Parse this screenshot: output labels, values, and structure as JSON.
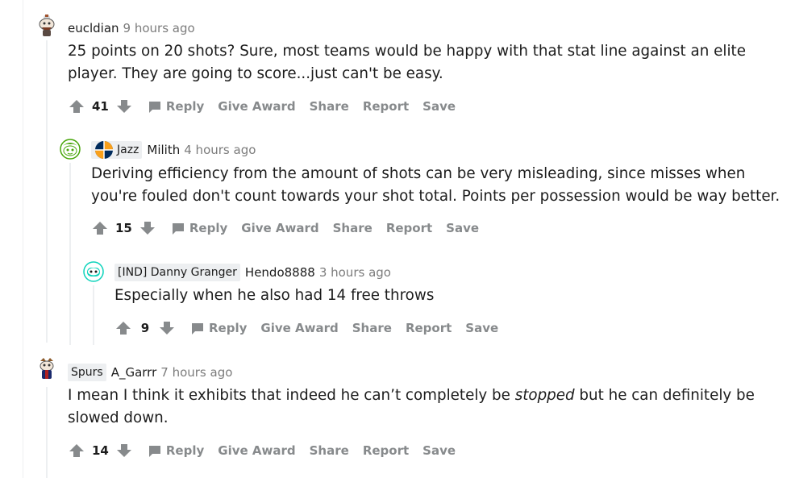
{
  "comments": [
    {
      "author": "eucldian",
      "time": "9 hours ago",
      "flair": "",
      "body_lines": [
        "25 points on 20 shots? Sure, most teams would be happy with that stat line against an elite",
        "player. They are going to score...just can't be easy."
      ],
      "score": "41"
    },
    {
      "author": "Milith",
      "time": "4 hours ago",
      "flair": "Jazz",
      "body_lines": [
        "Deriving efficiency from the amount of shots can be very misleading, since misses when",
        "you're fouled don't count towards your shot total. Points per possession would be way better."
      ],
      "score": "15"
    },
    {
      "author": "Hendo8888",
      "time": "3 hours ago",
      "flair": "[IND] Danny Granger",
      "body_lines": [
        "Especially when he also had 14 free throws"
      ],
      "score": "9"
    },
    {
      "author": "A_Garrr",
      "time": "7 hours ago",
      "flair": "Spurs",
      "body_lines_rich": {
        "line1_before": "I mean I think it exhibits that indeed he can’t completely be ",
        "line1_em": "stopped",
        "line1_after": " but he can definitely be",
        "line2": "slowed down."
      },
      "score": "14"
    }
  ],
  "actions": {
    "reply": "Reply",
    "give_award": "Give Award",
    "share": "Share",
    "report": "Report",
    "save": "Save"
  },
  "colors": {
    "action_gray": "#878a8c",
    "time_gray": "#7c7c7c",
    "flair_bg": "#edeff1",
    "thread_line": "#edeff1",
    "text": "#1c1c1c"
  },
  "icons": [
    "upvote-icon",
    "downvote-icon",
    "comment-icon",
    "avatar-icon",
    "jazz-logo-icon"
  ]
}
